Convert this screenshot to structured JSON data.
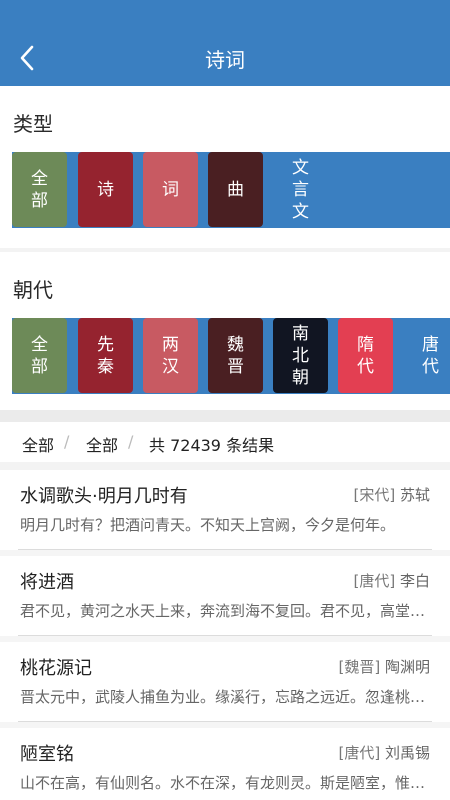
{
  "header": {
    "title": "诗词",
    "back_icon": "chevron-left-icon"
  },
  "type_section": {
    "title": "类型",
    "chips": [
      {
        "label": "全部",
        "color": "#3a7fc1"
      },
      {
        "label": "诗",
        "color": "#6d8a58"
      },
      {
        "label": "词",
        "color": "#95232f"
      },
      {
        "label": "曲",
        "color": "#c85a62"
      },
      {
        "label": "文言文",
        "color": "#4a1f22"
      }
    ]
  },
  "dynasty_section": {
    "title": "朝代",
    "chips": [
      {
        "label": "全部",
        "color": "#3a7fc1"
      },
      {
        "label": "先秦",
        "color": "#6d8a58"
      },
      {
        "label": "两汉",
        "color": "#95232f"
      },
      {
        "label": "魏晋",
        "color": "#c85a62"
      },
      {
        "label": "南北朝",
        "color": "#4a1f22"
      },
      {
        "label": "隋代",
        "color": "#111522"
      },
      {
        "label": "唐代",
        "color": "#e33f52"
      }
    ]
  },
  "filter": {
    "type": "全部",
    "dynasty": "全部",
    "separator": "/",
    "result_text": "共 72439 条结果"
  },
  "results": [
    {
      "title": "水调歌头·明月几时有",
      "dynasty": "[宋代]",
      "author": "苏轼",
      "excerpt": "明月几时有？把酒问青天。不知天上宫阙，今夕是何年。"
    },
    {
      "title": "将进酒",
      "dynasty": "[唐代]",
      "author": "李白",
      "excerpt": "君不见，黄河之水天上来，奔流到海不复回。君不见，高堂明镜悲白发"
    },
    {
      "title": "桃花源记",
      "dynasty": "[魏晋]",
      "author": "陶渊明",
      "excerpt": "晋太元中，武陵人捕鱼为业。缘溪行，忘路之远近。忽逢桃花林"
    },
    {
      "title": "陋室铭",
      "dynasty": "[唐代]",
      "author": "刘禹锡",
      "excerpt": "山不在高，有仙则名。水不在深，有龙则灵。斯是陋室，惟吾德馨"
    }
  ]
}
